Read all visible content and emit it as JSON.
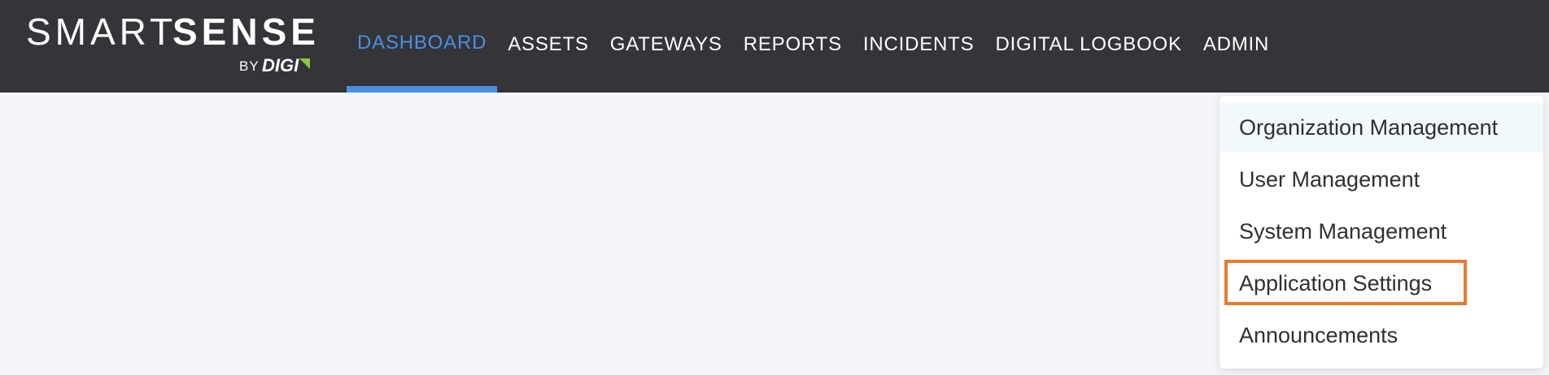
{
  "logo": {
    "smart": "SMART",
    "sense": "SENSE",
    "by": "BY",
    "digi": "DIGI",
    "accent_color": "#8dc63f"
  },
  "nav": {
    "items": [
      {
        "label": "DASHBOARD",
        "active": true
      },
      {
        "label": "ASSETS",
        "active": false
      },
      {
        "label": "GATEWAYS",
        "active": false
      },
      {
        "label": "REPORTS",
        "active": false
      },
      {
        "label": "INCIDENTS",
        "active": false
      },
      {
        "label": "DIGITAL LOGBOOK",
        "active": false
      },
      {
        "label": "ADMIN",
        "active": false
      }
    ],
    "active_color": "#4a90e2",
    "background": "#343439"
  },
  "admin_menu": {
    "items": [
      {
        "label": "Organization Management",
        "hovered": true
      },
      {
        "label": "User Management"
      },
      {
        "label": "System Management"
      },
      {
        "label": "Application Settings",
        "highlighted": true
      },
      {
        "label": "Announcements"
      }
    ],
    "highlight_color": "#ea7a30"
  }
}
